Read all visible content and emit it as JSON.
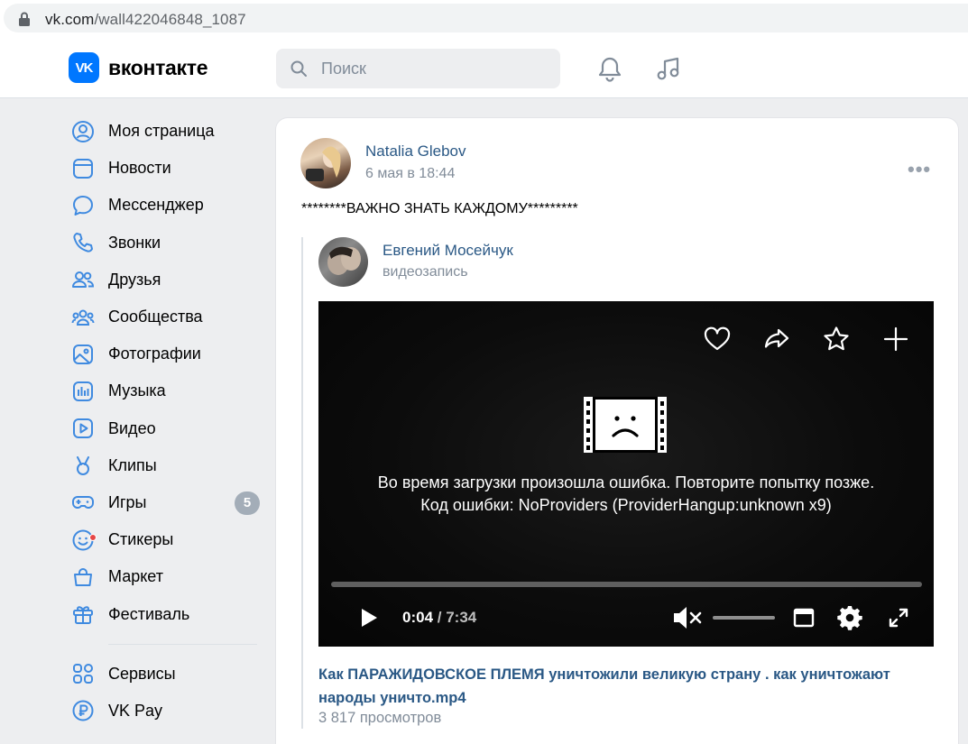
{
  "browser": {
    "url_domain": "vk.com",
    "url_path": "/wall422046848_1087"
  },
  "header": {
    "logo_badge": "VK",
    "logo_text": "вконтакте",
    "search_placeholder": "Поиск"
  },
  "sidebar": {
    "items": [
      {
        "label": "Моя страница",
        "icon": "user-circle-icon"
      },
      {
        "label": "Новости",
        "icon": "news-icon"
      },
      {
        "label": "Мессенджер",
        "icon": "message-icon"
      },
      {
        "label": "Звонки",
        "icon": "phone-icon"
      },
      {
        "label": "Друзья",
        "icon": "friends-icon"
      },
      {
        "label": "Сообщества",
        "icon": "communities-icon"
      },
      {
        "label": "Фотографии",
        "icon": "photo-icon"
      },
      {
        "label": "Музыка",
        "icon": "music-icon"
      },
      {
        "label": "Видео",
        "icon": "video-icon"
      },
      {
        "label": "Клипы",
        "icon": "clips-icon"
      },
      {
        "label": "Игры",
        "icon": "games-icon",
        "badge": "5"
      },
      {
        "label": "Стикеры",
        "icon": "stickers-icon"
      },
      {
        "label": "Маркет",
        "icon": "market-icon"
      },
      {
        "label": "Фестиваль",
        "icon": "festival-icon"
      }
    ],
    "extra_items": [
      {
        "label": "Сервисы",
        "icon": "services-icon"
      },
      {
        "label": "VK Pay",
        "icon": "vkpay-icon"
      }
    ]
  },
  "post": {
    "author": "Natalia Glebov",
    "date": "6 мая в 18:44",
    "text": "********ВАЖНО ЗНАТЬ КАЖДОМУ*********",
    "more": "•••",
    "repost": {
      "author": "Евгений Мосейчук",
      "subtitle": "видеозапись"
    },
    "video": {
      "error_line1": "Во время загрузки произошла ошибка. Повторите попытку позже.",
      "error_line2": "Код ошибки: NoProviders (ProviderHangup:unknown x9)",
      "time_current": "0:04",
      "time_separator": " / ",
      "time_total": "7:34",
      "title": "Как ПАРАЖИДОВСКОЕ ПЛЕМЯ уничтожили великую страну . как уничтожают народы уничто.mp4",
      "views": "3 817 просмотров"
    }
  },
  "colors": {
    "link": "#2a5885",
    "vk_blue": "#0077ff",
    "page_bg": "#edeef0",
    "muted": "#818c99"
  }
}
